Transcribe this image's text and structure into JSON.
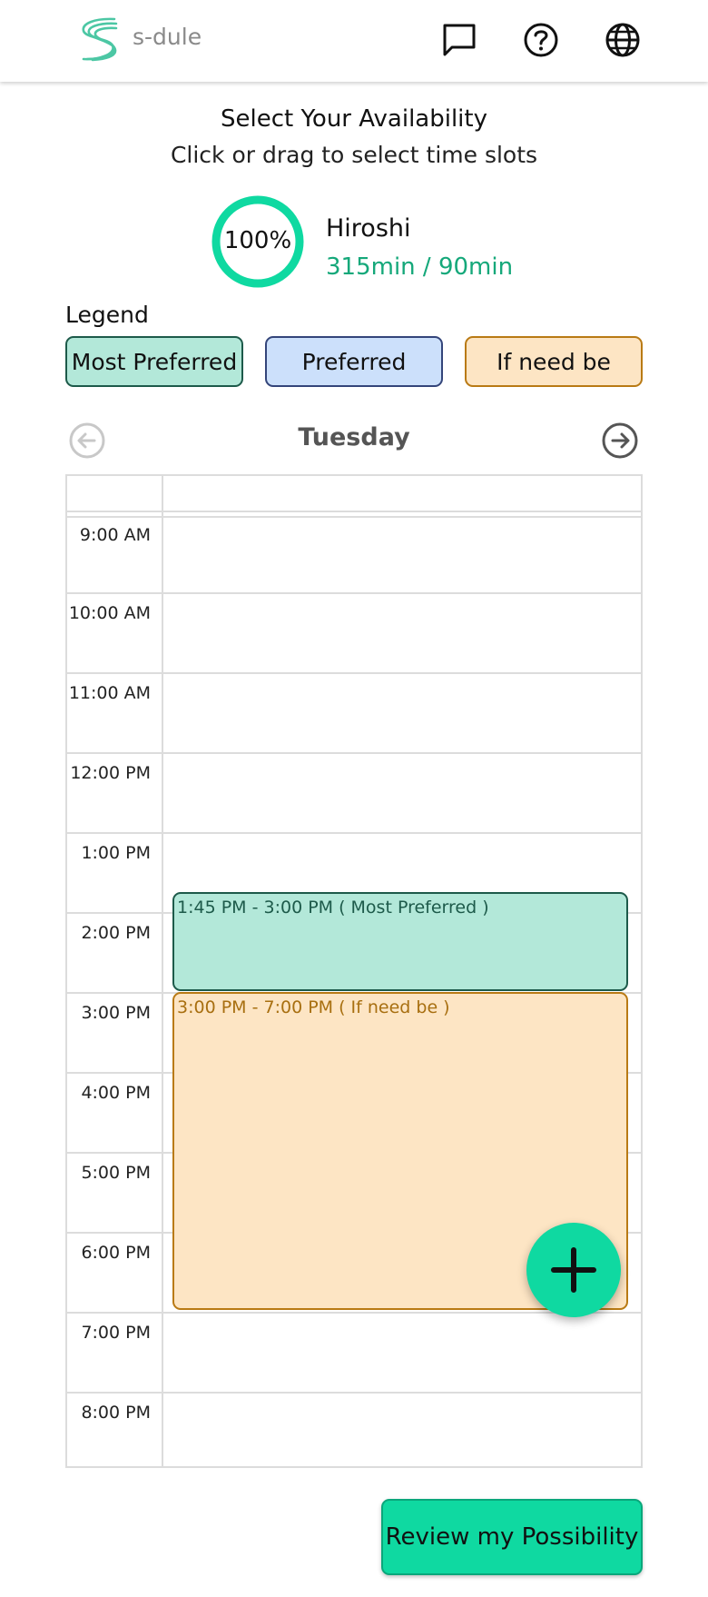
{
  "app": {
    "brand": "s-dule",
    "accent": "#0fd9a1"
  },
  "header": {
    "icons": [
      "chat-icon",
      "help-icon",
      "globe-icon"
    ]
  },
  "heading": {
    "title": "Select Your Availability",
    "subtitle": "Click or drag to select time slots"
  },
  "progress": {
    "percent_label": "100%",
    "value": 100,
    "user": "Hiroshi",
    "minutes": "315min / 90min"
  },
  "legend": {
    "label": "Legend",
    "items": [
      {
        "label": "Most Preferred",
        "color": "#b3e8d9"
      },
      {
        "label": "Preferred",
        "color": "#cce0fb"
      },
      {
        "label": "If need be",
        "color": "#fde5c4"
      }
    ]
  },
  "calendar": {
    "day": "Tuesday",
    "hours": [
      "9:00 AM",
      "10:00 AM",
      "11:00 AM",
      "12:00 PM",
      "1:00 PM",
      "2:00 PM",
      "3:00 PM",
      "4:00 PM",
      "5:00 PM",
      "6:00 PM",
      "7:00 PM",
      "8:00 PM"
    ],
    "events": [
      {
        "label": "1:45 PM - 3:00 PM ( Most Preferred )",
        "level": "Most Preferred"
      },
      {
        "label": "3:00 PM - 7:00 PM ( If need be )",
        "level": "If need be"
      }
    ]
  },
  "actions": {
    "review_label": "Review my Possibility"
  }
}
